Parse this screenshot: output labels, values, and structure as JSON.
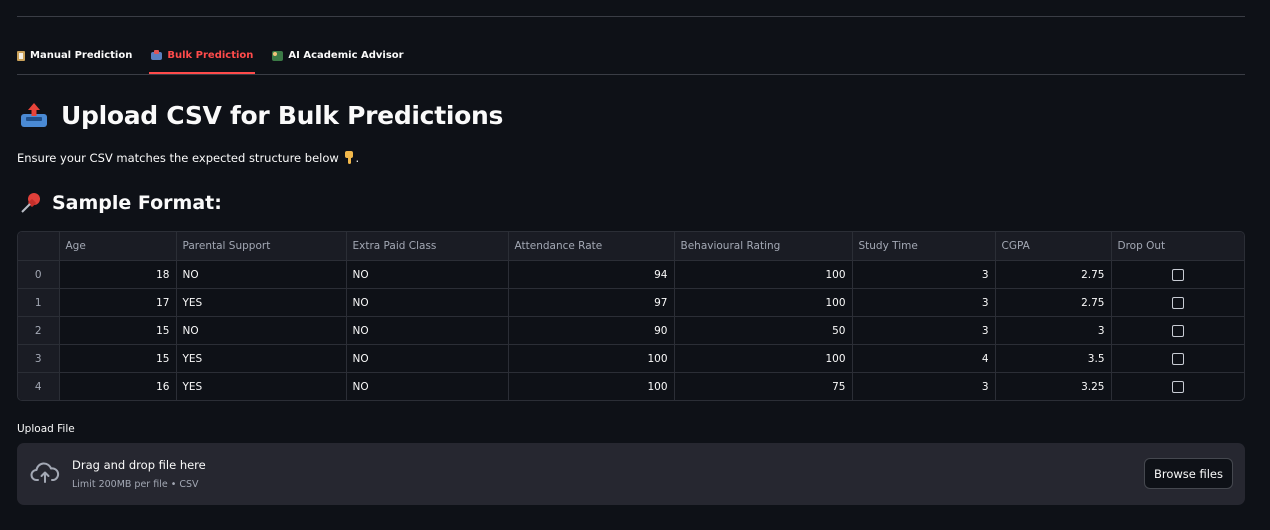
{
  "tabs": [
    {
      "label": "Manual Prediction",
      "icon": "clipboard-icon",
      "active": false
    },
    {
      "label": "Bulk Prediction",
      "icon": "inbox-tray-icon",
      "active": true
    },
    {
      "label": "AI Academic Advisor",
      "icon": "teacher-icon",
      "active": false
    }
  ],
  "colors": {
    "accent": "#ff4b4b",
    "background": "#0e1117",
    "surface": "#262730"
  },
  "heading": {
    "icon": "inbox-tray-icon",
    "title": "Upload CSV for Bulk Predictions"
  },
  "caption": {
    "text": "Ensure your CSV matches the expected structure below",
    "icon": "pointing-down-icon",
    "suffix": "."
  },
  "sample": {
    "icon": "pushpin-icon",
    "title": "Sample Format:"
  },
  "table": {
    "columns": [
      "Age",
      "Parental Support",
      "Extra Paid Class",
      "Attendance Rate",
      "Behavioural Rating",
      "Study Time",
      "CGPA",
      "Drop Out"
    ],
    "rows": [
      {
        "index": "0",
        "age": "18",
        "parental_support": "NO",
        "extra_paid_class": "NO",
        "attendance_rate": "94",
        "behavioural_rating": "100",
        "study_time": "3",
        "cgpa": "2.75",
        "drop_out": false
      },
      {
        "index": "1",
        "age": "17",
        "parental_support": "YES",
        "extra_paid_class": "NO",
        "attendance_rate": "97",
        "behavioural_rating": "100",
        "study_time": "3",
        "cgpa": "2.75",
        "drop_out": false
      },
      {
        "index": "2",
        "age": "15",
        "parental_support": "NO",
        "extra_paid_class": "NO",
        "attendance_rate": "90",
        "behavioural_rating": "50",
        "study_time": "3",
        "cgpa": "3",
        "drop_out": false
      },
      {
        "index": "3",
        "age": "15",
        "parental_support": "YES",
        "extra_paid_class": "NO",
        "attendance_rate": "100",
        "behavioural_rating": "100",
        "study_time": "4",
        "cgpa": "3.5",
        "drop_out": false
      },
      {
        "index": "4",
        "age": "16",
        "parental_support": "YES",
        "extra_paid_class": "NO",
        "attendance_rate": "100",
        "behavioural_rating": "75",
        "study_time": "3",
        "cgpa": "3.25",
        "drop_out": false
      }
    ]
  },
  "upload": {
    "label": "Upload File",
    "dropzone_title": "Drag and drop file here",
    "dropzone_hint": "Limit 200MB per file • CSV",
    "icon": "cloud-upload-icon",
    "button_label": "Browse files"
  }
}
